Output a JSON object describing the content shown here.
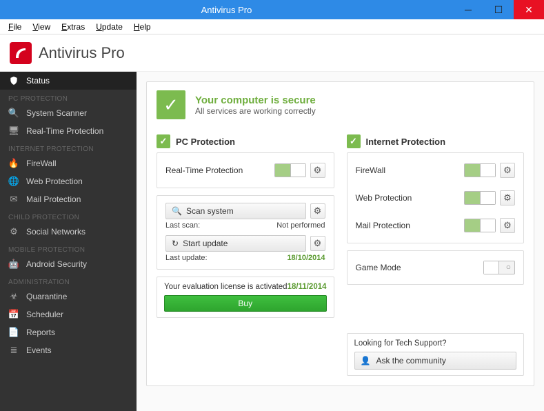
{
  "window": {
    "title": "Antivirus Pro"
  },
  "menu": {
    "file": "File",
    "view": "View",
    "extras": "Extras",
    "update": "Update",
    "help": "Help"
  },
  "header": {
    "name": "Antivirus Pro"
  },
  "sidebar": {
    "status": "Status",
    "sections": [
      {
        "header": "PC PROTECTION",
        "items": [
          {
            "icon": "search",
            "label": "System Scanner"
          },
          {
            "icon": "monitor",
            "label": "Real-Time Protection"
          }
        ]
      },
      {
        "header": "INTERNET PROTECTION",
        "items": [
          {
            "icon": "flame",
            "label": "FireWall"
          },
          {
            "icon": "globe",
            "label": "Web Protection"
          },
          {
            "icon": "mail",
            "label": "Mail Protection"
          }
        ]
      },
      {
        "header": "CHILD PROTECTION",
        "items": [
          {
            "icon": "gear",
            "label": "Social Networks"
          }
        ]
      },
      {
        "header": "MOBILE PROTECTION",
        "items": [
          {
            "icon": "android",
            "label": "Android Security"
          }
        ]
      },
      {
        "header": "ADMINISTRATION",
        "items": [
          {
            "icon": "biohazard",
            "label": "Quarantine"
          },
          {
            "icon": "calendar",
            "label": "Scheduler"
          },
          {
            "icon": "doc",
            "label": "Reports"
          },
          {
            "icon": "list",
            "label": "Events"
          }
        ]
      }
    ]
  },
  "banner": {
    "title": "Your computer is secure",
    "subtitle": "All services are working correctly"
  },
  "pc": {
    "title": "PC Protection",
    "rtp": {
      "label": "Real-Time Protection",
      "on": true
    },
    "scan_btn": "Scan system",
    "last_scan_label": "Last scan:",
    "last_scan_value": "Not performed",
    "update_btn": "Start update",
    "last_update_label": "Last update:",
    "last_update_value": "18/10/2014"
  },
  "license": {
    "text": "Your evaluation license is activated",
    "date": "18/11/2014",
    "buy": "Buy"
  },
  "net": {
    "title": "Internet Protection",
    "items": [
      {
        "label": "FireWall",
        "on": true
      },
      {
        "label": "Web Protection",
        "on": true
      },
      {
        "label": "Mail Protection",
        "on": true
      }
    ],
    "game_mode_label": "Game Mode",
    "game_mode_on": false
  },
  "support": {
    "question": "Looking for Tech Support?",
    "button": "Ask the community"
  }
}
